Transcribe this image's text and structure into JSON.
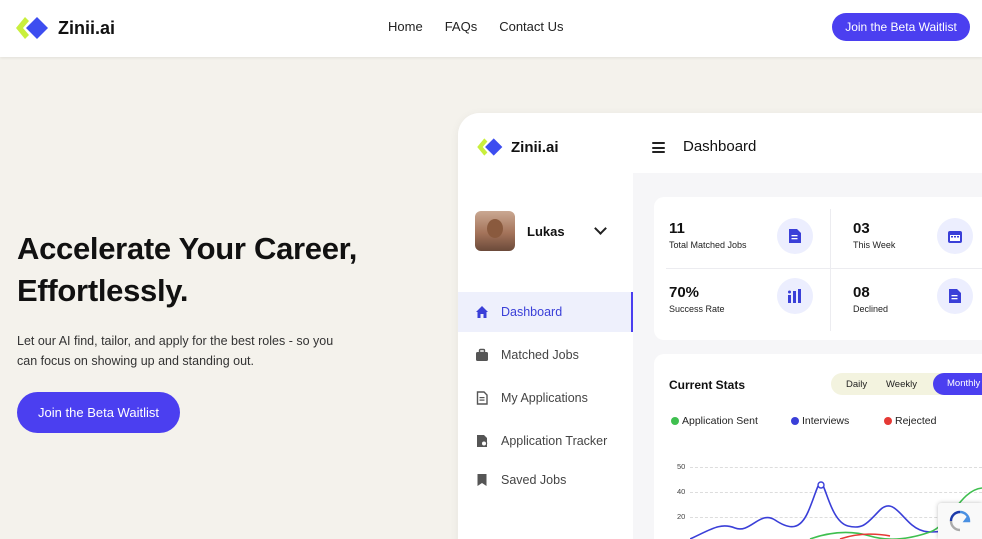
{
  "header": {
    "brand": "Zinii.ai",
    "nav": [
      "Home",
      "FAQs",
      "Contact Us"
    ],
    "cta": "Join the Beta Waitlist"
  },
  "hero": {
    "title_line1": "Accelerate Your Career,",
    "title_line2": "Effortlessly.",
    "subtitle_line1": "Let our AI find, tailor, and apply for the best roles - so you",
    "subtitle_line2": "can focus on showing up and standing out.",
    "cta": "Join the Beta Waitlist"
  },
  "app": {
    "brand": "Zinii.ai",
    "header_title": "Dashboard",
    "user": {
      "name": "Lukas"
    },
    "sidebar": [
      {
        "label": "Dashboard",
        "icon": "home-icon",
        "active": true
      },
      {
        "label": "Matched Jobs",
        "icon": "briefcase-icon"
      },
      {
        "label": "My Applications",
        "icon": "document-icon"
      },
      {
        "label": "Application Tracker",
        "icon": "tracker-icon"
      },
      {
        "label": "Saved Jobs",
        "icon": "bookmark-icon"
      }
    ],
    "stats": [
      {
        "value": "11",
        "label": "Total Matched Jobs",
        "icon": "document-icon"
      },
      {
        "value": "03",
        "label": "This Week",
        "icon": "calendar-icon"
      },
      {
        "value": "70%",
        "label": "Success Rate",
        "icon": "bar-chart-icon"
      },
      {
        "value": "08",
        "label": "Declined",
        "icon": "document-icon"
      }
    ],
    "current_stats": {
      "title": "Current Stats",
      "periods": [
        "Daily",
        "Weekly",
        "Monthly"
      ],
      "selected_period": "Monthly",
      "legend": [
        {
          "name": "Application Sent",
          "color": "#3fbf4f"
        },
        {
          "name": "Interviews",
          "color": "#3a3fd8"
        },
        {
          "name": "Rejected",
          "color": "#e53935"
        }
      ],
      "y_ticks": [
        "50",
        "40",
        "20"
      ]
    }
  },
  "colors": {
    "accent": "#4b3ff0",
    "logo_lime": "#c9ef3d",
    "logo_blue": "#3d4df0",
    "page_bg": "#f4f2ec"
  }
}
